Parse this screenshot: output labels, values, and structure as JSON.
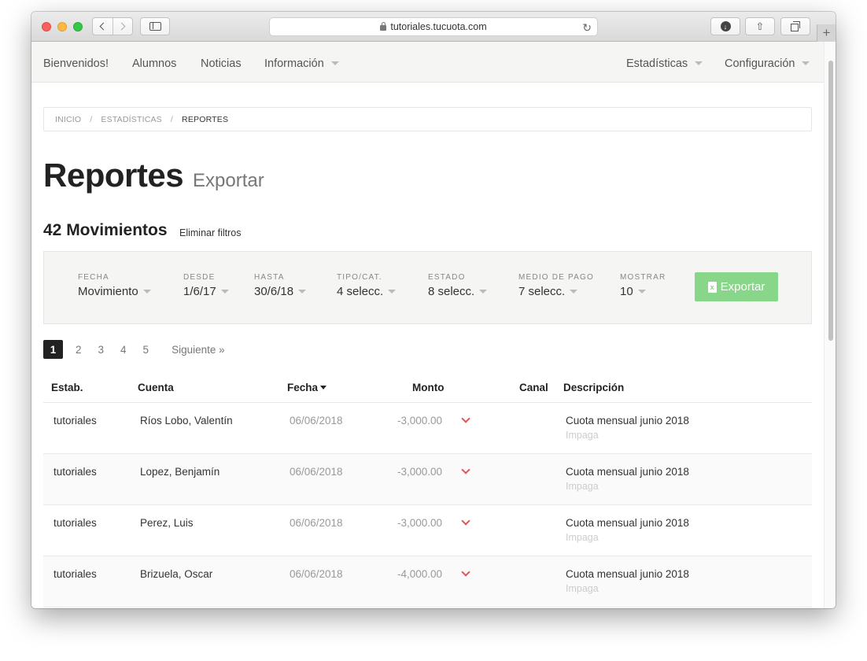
{
  "browser": {
    "url": "tutoriales.tucuota.com"
  },
  "topnav": {
    "left": [
      "Bienvenidos!",
      "Alumnos",
      "Noticias",
      "Información"
    ],
    "right": [
      "Estadísticas",
      "Configuración"
    ]
  },
  "breadcrumb": [
    "INICIO",
    "ESTADÍSTICAS",
    "REPORTES"
  ],
  "page": {
    "title": "Reportes",
    "subtitle": "Exportar",
    "count_title": "42 Movimientos",
    "clear_filters": "Eliminar filtros"
  },
  "filters": [
    {
      "label": "FECHA",
      "value": "Movimiento"
    },
    {
      "label": "DESDE",
      "value": "1/6/17"
    },
    {
      "label": "HASTA",
      "value": "30/6/18"
    },
    {
      "label": "TIPO/CAT.",
      "value": "4 selecc."
    },
    {
      "label": "ESTADO",
      "value": "8 selecc."
    },
    {
      "label": "MEDIO DE PAGO",
      "value": "7 selecc."
    },
    {
      "label": "MOSTRAR",
      "value": "10"
    }
  ],
  "export_button": "Exportar",
  "pagination": {
    "pages": [
      "1",
      "2",
      "3",
      "4",
      "5"
    ],
    "current": "1",
    "next": "Siguiente »"
  },
  "table": {
    "headers": [
      "Estab.",
      "Cuenta",
      "Fecha",
      "Monto",
      "Canal",
      "Descripción"
    ],
    "rows": [
      {
        "estab": "tutoriales",
        "cuenta": "Ríos Lobo, Valentín",
        "fecha": "06/06/2018",
        "monto": "-3,000.00",
        "canal": "",
        "descripcion": "Cuota mensual junio 2018",
        "estado": "Impaga"
      },
      {
        "estab": "tutoriales",
        "cuenta": "Lopez, Benjamín",
        "fecha": "06/06/2018",
        "monto": "-3,000.00",
        "canal": "",
        "descripcion": "Cuota mensual junio 2018",
        "estado": "Impaga"
      },
      {
        "estab": "tutoriales",
        "cuenta": "Perez, Luis",
        "fecha": "06/06/2018",
        "monto": "-3,000.00",
        "canal": "",
        "descripcion": "Cuota mensual junio 2018",
        "estado": "Impaga"
      },
      {
        "estab": "tutoriales",
        "cuenta": "Brizuela, Oscar",
        "fecha": "06/06/2018",
        "monto": "-4,000.00",
        "canal": "",
        "descripcion": "Cuota mensual junio 2018",
        "estado": "Impaga"
      }
    ]
  },
  "colors": {
    "export_button": "#88d68a",
    "negative_arrow": "#e05656",
    "active_page": "#222222"
  }
}
